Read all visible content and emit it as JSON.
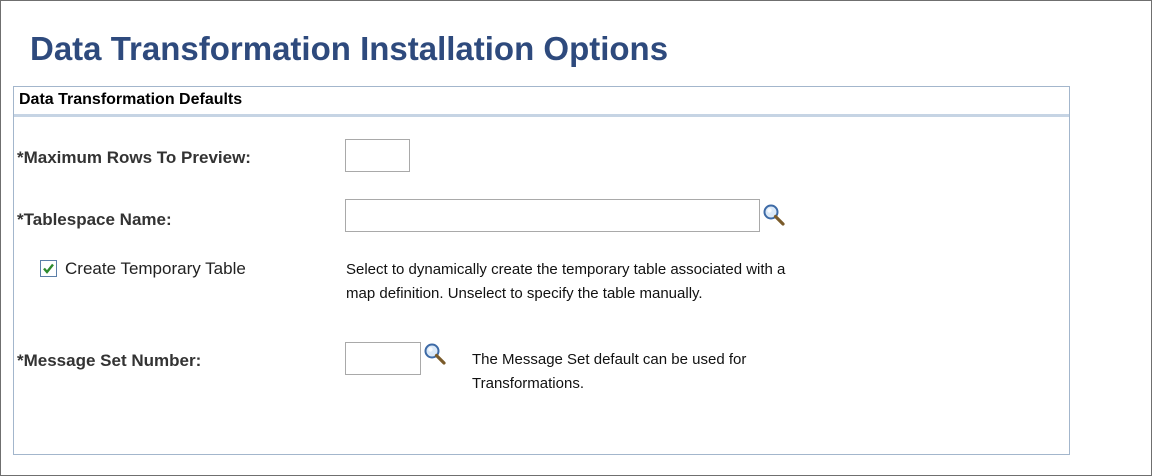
{
  "page": {
    "title": "Data Transformation Installation Options"
  },
  "group": {
    "header": "Data Transformation Defaults"
  },
  "fields": {
    "max_rows": {
      "label": "*Maximum Rows To Preview:",
      "value": ""
    },
    "tablespace": {
      "label": "*Tablespace Name:",
      "value": ""
    },
    "create_temp": {
      "label": "Create Temporary Table",
      "checked": true,
      "description_line1": "Select to dynamically create the temporary table associated with a",
      "description_line2": "map definition. Unselect to specify the table manually."
    },
    "message_set": {
      "label": "*Message Set Number:",
      "value": "",
      "description_line1": "The Message Set default can be used for",
      "description_line2": "Transformations."
    }
  },
  "icons": {
    "lookup": "magnifier-icon",
    "check": "checkmark-icon"
  },
  "colors": {
    "title": "#2e4a7d",
    "group_border": "#a3b6cc",
    "check": "#2e8b2e"
  }
}
